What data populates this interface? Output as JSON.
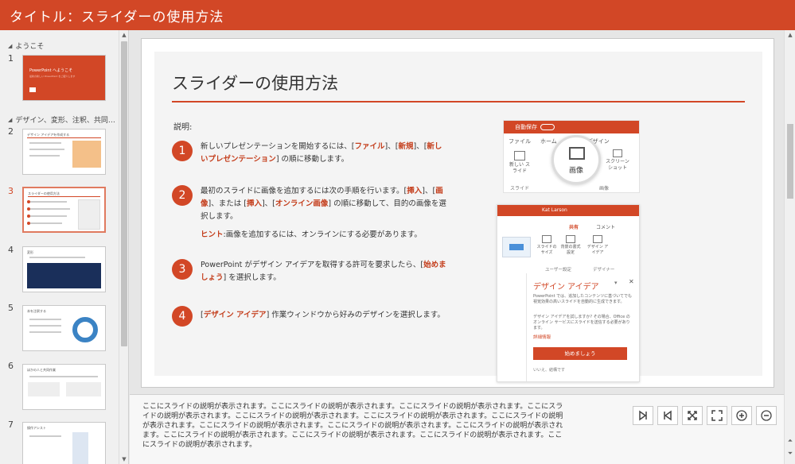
{
  "window": {
    "title": "タイトル：スライダーの使用方法"
  },
  "sidebar": {
    "sections": [
      {
        "label": "ようこそ"
      },
      {
        "label": "デザイン、変形、注釈、共同…"
      }
    ],
    "slides": [
      {
        "number": "1",
        "title": "PowerPoint へようこそ",
        "subtitle": "最新の新しい PowerPoint をご紹介します"
      },
      {
        "number": "2",
        "title": "デザイン アイデアを作成する"
      },
      {
        "number": "3",
        "title": "スライダーの使用方法"
      },
      {
        "number": "4",
        "title": "変形"
      },
      {
        "number": "5",
        "title": "本を注釈する"
      },
      {
        "number": "6",
        "title": "ほかの人と共同作業"
      },
      {
        "number": "7",
        "title": "操作アシスト"
      }
    ],
    "selected_slide": "3"
  },
  "slide": {
    "title": "スライダーの使用方法",
    "description_label": "説明:",
    "steps": [
      {
        "number": "1",
        "pre": "新しいプレゼンテーションを開始するには、[",
        "h1": "ファイル",
        "mid1": "]、[",
        "h2": "新規",
        "mid2": "]、[",
        "h3": "新しいプレゼンテーション",
        "post": "] の順に移動します。"
      },
      {
        "number": "2",
        "pre": "最初のスライドに画像を追加するには次の手順を行います。[",
        "h1": "挿入",
        "mid1": "]、[",
        "h2": "画像",
        "mid2": "]、または [",
        "h3": "挿入",
        "mid3": "]、[",
        "h4": "オンライン画像",
        "post": "] の順に移動して、目的の画像を選択します。"
      },
      {
        "number": "3",
        "pre": "PowerPoint がデザイン アイデアを取得する許可を要求したら、[",
        "h1": "始めましょう",
        "post": "] を選択します。"
      },
      {
        "number": "4",
        "pre": "[",
        "h1": "デザイン アイデア",
        "post": "] 作業ウィンドウから好みのデザインを選択します。"
      }
    ],
    "hint": {
      "label": "ヒント",
      "text": ":画像を追加するには、オンラインにする必要があります。"
    },
    "illustration": {
      "autosave": "自動保存",
      "tabs": [
        "ファイル",
        "ホーム",
        "挿入",
        "デザイン"
      ],
      "new_slide": "新しい スライド",
      "slide_group": "スライド",
      "image_group": "画像",
      "image_button": "画像",
      "screenshot": "スクリーン ショット",
      "user": "Kat Larson",
      "share": "共有",
      "comment": "コメント",
      "slide_size": "スライドの サイズ",
      "format_bg": "背景の書式設定",
      "design_ideas_btn": "デザイン アイデア",
      "user_settings": "ユーザー設定",
      "designer": "デザイナー",
      "pane_title": "デザイン アイデア",
      "pane_text1": "PowerPoint では、追加したコンテンツに基づいてでも視覚効果の高いスライドを自動的に生成できます。",
      "pane_text2": "デザイン アイデアを試しますか? その場合、Office のオンライン サービスにスライドを送信する必要があります。",
      "details": "詳細情報",
      "start_button": "始めましょう",
      "decline": "いいえ、結構です"
    }
  },
  "notes": {
    "text": "ここにスライドの説明が表示されます。ここにスライドの説明が表示されます。ここにスライドの説明が表示されます。ここにスライドの説明が表示されます。ここにスライドの説明が表示されます。ここにスライドの説明が表示されます。ここにスライドの説明が表示されます。ここにスライドの説明が表示されます。ここにスライドの説明が表示されます。ここにスライドの説明が表示されます。ここにスライドの説明が表示されます。ここにスライドの説明が表示されます。ここにスライドの説明が表示されます。ここにスライドの説明が表示されます。"
  },
  "controls": [
    "next-slide-icon",
    "previous-slide-icon",
    "exit-fullscreen-icon",
    "fullscreen-icon",
    "zoom-in-icon",
    "zoom-out-icon"
  ],
  "colors": {
    "accent": "#d24726",
    "background": "#e6e6e6",
    "highlight_text": "#c43e1c"
  }
}
